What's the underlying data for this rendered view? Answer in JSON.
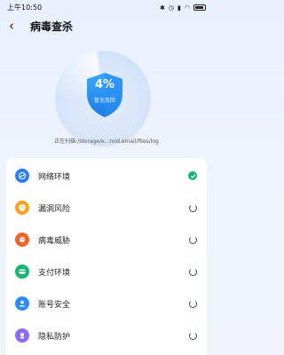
{
  "status_bar": {
    "time": "上午10:50",
    "network": "4G",
    "signal": "..."
  },
  "header": {
    "title": "病毒查杀"
  },
  "scan": {
    "percent": "4%",
    "subtitle": "暂无风险",
    "path_text": "正在扫描:/storage/e...roid.email/files/log",
    "progress": 0.04
  },
  "checks": [
    {
      "label": "网络环境",
      "icon": "globe-icon",
      "color": "#2d7cf5",
      "status": "done"
    },
    {
      "label": "漏洞风险",
      "icon": "shield-alert-icon",
      "color": "#f6a623",
      "status": "scanning"
    },
    {
      "label": "病毒威胁",
      "icon": "virus-icon",
      "color": "#f2642f",
      "status": "scanning"
    },
    {
      "label": "支付环境",
      "icon": "card-icon",
      "color": "#18b574",
      "status": "scanning"
    },
    {
      "label": "账号安全",
      "icon": "user-icon",
      "color": "#2d8cf5",
      "status": "scanning"
    },
    {
      "label": "隐私防护",
      "icon": "privacy-icon",
      "color": "#8b6cf2",
      "status": "scanning"
    }
  ],
  "colors": {
    "accent": "#2d7cf5",
    "check_done": "#16b27a"
  }
}
